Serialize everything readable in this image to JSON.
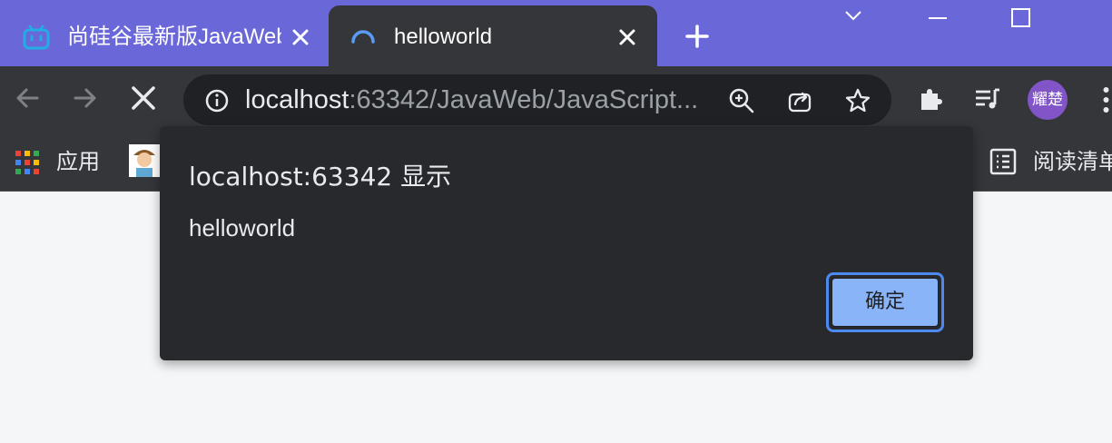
{
  "tabs": [
    {
      "title": "尚硅谷最新版JavaWeb全套教程",
      "icon": "bilibili-tv-icon",
      "active": false
    },
    {
      "title": "helloworld",
      "icon": "loading-spinner-icon",
      "active": true
    }
  ],
  "window_controls": [
    "tab-search",
    "minimize",
    "maximize"
  ],
  "omnibox": {
    "host": "localhost",
    "path": ":63342/JavaWeb/JavaScript...",
    "icons": [
      "info-icon",
      "zoom-icon",
      "share-icon",
      "bookmark-star-icon"
    ]
  },
  "profile": {
    "initials": "耀楚"
  },
  "bookmarks": {
    "apps_label": "应用",
    "reading_list_label": "阅读清单"
  },
  "dialog": {
    "title": "localhost:63342 显示",
    "message": "helloworld",
    "ok_label": "确定"
  },
  "colors": {
    "titlebar": "#6a67d9",
    "toolbar": "#35363a",
    "dialog_bg": "#28292c",
    "ok_button": "#8ab4f8",
    "focus_ring": "#4d8af0",
    "page_bg": "#f5f6f8"
  }
}
